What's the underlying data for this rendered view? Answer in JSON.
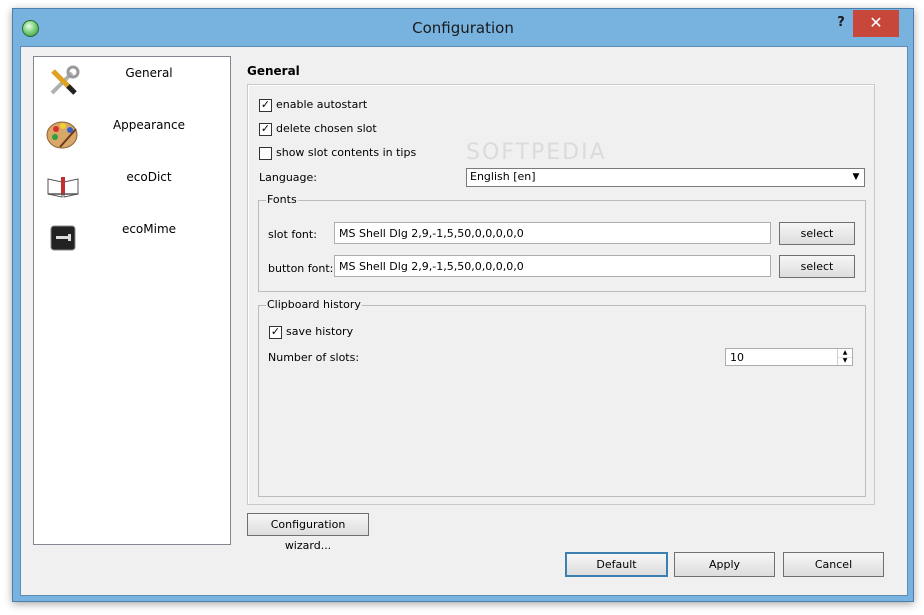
{
  "window": {
    "title": "Configuration",
    "help_label": "?",
    "close_label": "✕"
  },
  "sidebar": {
    "items": [
      {
        "label": "General",
        "icon": "tools-icon"
      },
      {
        "label": "Appearance",
        "icon": "palette-icon"
      },
      {
        "label": "ecoDict",
        "icon": "book-icon"
      },
      {
        "label": "ecoMime",
        "icon": "terminal-icon"
      }
    ]
  },
  "general": {
    "section_title": "General",
    "enable_autostart": {
      "label": "enable autostart",
      "checked": true
    },
    "delete_chosen_slot": {
      "label": "delete chosen slot",
      "checked": true
    },
    "show_slot_contents": {
      "label": "show slot contents in tips",
      "checked": false
    },
    "language_label": "Language:",
    "language_value": "English [en]",
    "fonts": {
      "title": "Fonts",
      "slot_font_label": "slot font:",
      "slot_font_value": "MS Shell Dlg 2,9,-1,5,50,0,0,0,0,0",
      "button_font_label": "button font:",
      "button_font_value": "MS Shell Dlg 2,9,-1,5,50,0,0,0,0,0",
      "select_label": "select"
    },
    "clipboard": {
      "title": "Clipboard history",
      "save_history": {
        "label": "save history",
        "checked": true
      },
      "slots_label": "Number of slots:",
      "slots_value": "10"
    }
  },
  "footer": {
    "wizard_label": "Configuration wizard...",
    "default_label": "Default",
    "apply_label": "Apply",
    "cancel_label": "Cancel"
  },
  "watermark": "SOFTPEDIA",
  "colors": {
    "titlebar": "#78b3e0",
    "close": "#c7473b",
    "client": "#f0f0f0"
  }
}
